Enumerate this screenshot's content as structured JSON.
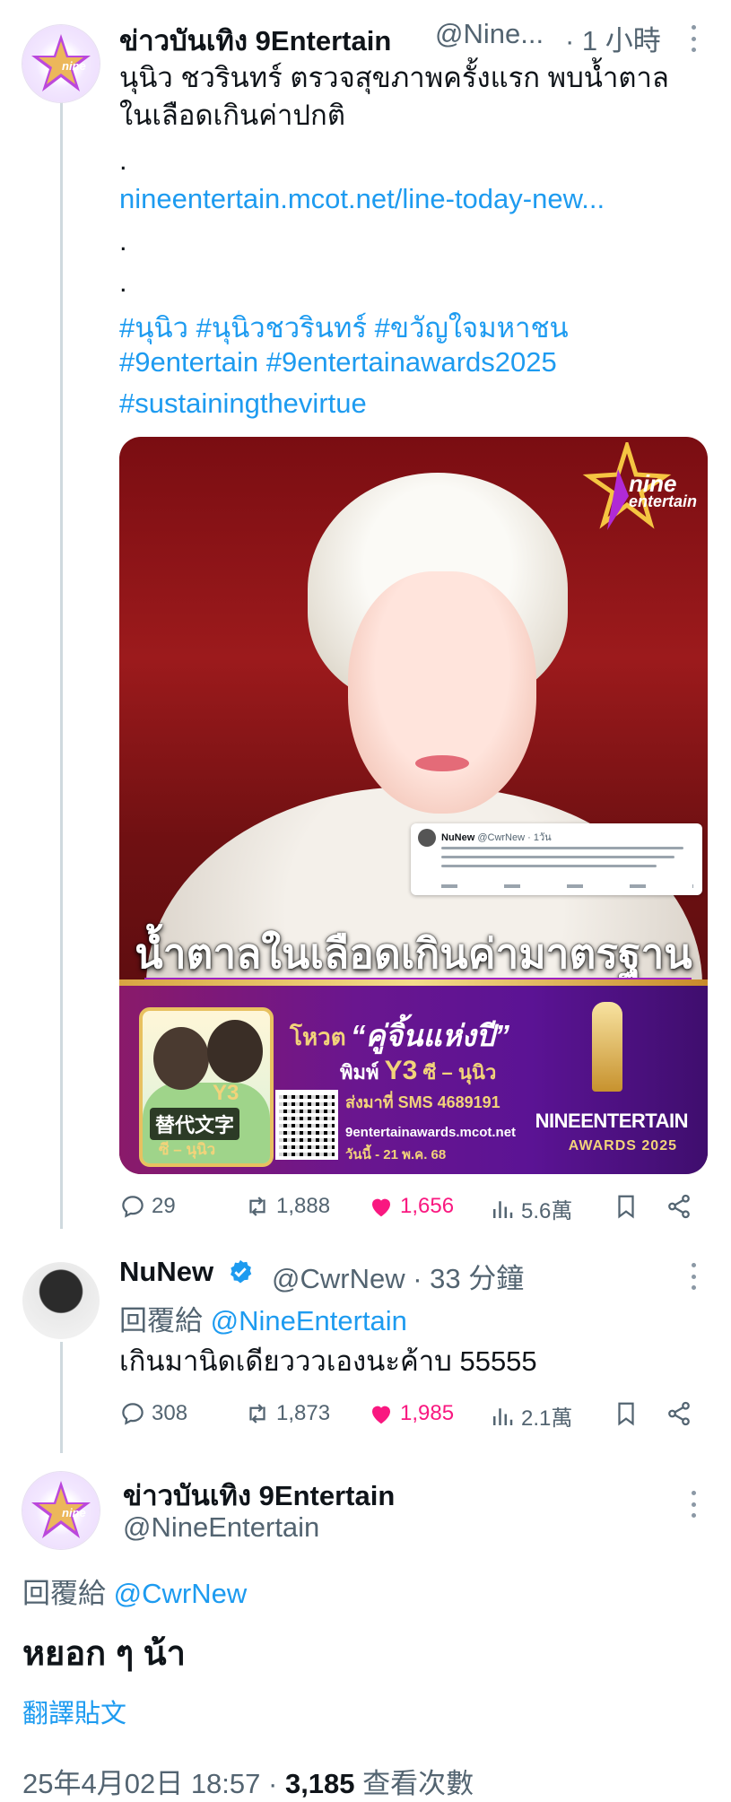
{
  "post1": {
    "author_name": "ข่าวบันเทิง 9Entertain",
    "handle": "@Nine...",
    "time": "· 1 小時",
    "avatar_text": "nine entertain",
    "text_lines": [
      "นุนิว ชวรินทร์ ตรวจสุขภาพครั้งแรก พบน้ำตาล",
      "ในเลือดเกินค่าปกติ",
      "."
    ],
    "link": "nineentertain.mcot.net/line-today-new...",
    "dots": [
      ".",
      "."
    ],
    "hashtags": [
      "#นุนิว #นุนิวชวรินทร์ #ขวัญใจมหาชน",
      "#9entertain #9entertainawards2025",
      "#sustainingthevirtue"
    ],
    "media": {
      "logo_text_1": "nine",
      "logo_text_2": "entertain",
      "headline": "น้ำตาลในเลือดเกินค่ามาตรฐาน",
      "embedded_author": "NuNew",
      "embedded_handle": "@CwrNew · 1วัน",
      "vote_label": "โหวต",
      "vote_title": "“คู่จิ้นแห่งปี”",
      "vote_code_prefix": "พิมพ์",
      "vote_code": "Y3",
      "vote_code_suffix": "ซี – นุนิว",
      "vote_sms": "ส่งมาที่ SMS 4689191",
      "vote_url": "9entertainawards.mcot.net",
      "vote_date": "วันนี้ - 21 พ.ค. 68",
      "duo_code": "Y3",
      "duo_caption": "ซี – นุนิว",
      "alt_badge": "替代文字",
      "award_line1": "NINEENTERTAIN",
      "award_line2": "AWARDS 2025"
    },
    "actions": {
      "replies": "29",
      "reposts": "1,888",
      "likes": "1,656",
      "views": "5.6萬"
    }
  },
  "post2": {
    "author_name": "NuNew",
    "handle": "@CwrNew · 33 分鐘",
    "reply_label": "回覆給",
    "reply_to": "@NineEntertain",
    "text": "เกินมานิดเดียวววเองนะค้าบ 55555",
    "actions": {
      "replies": "308",
      "reposts": "1,873",
      "likes": "1,985",
      "views": "2.1萬"
    }
  },
  "post3": {
    "author_name": "ข่าวบันเทิง 9Entertain",
    "handle": "@NineEntertain",
    "reply_label": "回覆給",
    "reply_to": "@CwrNew",
    "text": "หยอก ๆ น้า",
    "translate": "翻譯貼文",
    "timestamp": "25年4月02日 18:57 · ",
    "views_count": "3,185",
    "views_label": " 查看次數"
  },
  "colors": {
    "link": "#1d9bf0",
    "like": "#f91880",
    "muted": "#536471",
    "verified": "#1d9bf0"
  }
}
